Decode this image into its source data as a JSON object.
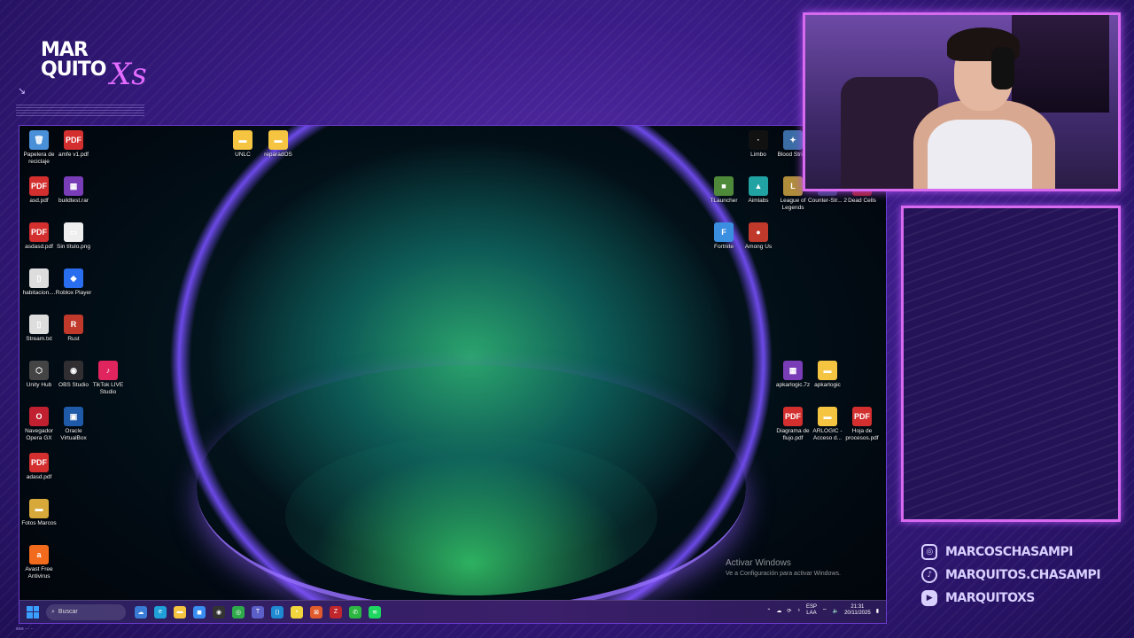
{
  "overlay": {
    "brand_line1": "MAR",
    "brand_line2": "QUITO",
    "brand_script": "Xs",
    "brand_arrow": "↘",
    "bottom_tiny": "≡≡≡ ··· ··"
  },
  "desktop_icons": [
    {
      "label": "Papelera de reciclaje",
      "glyph": "🗑",
      "color": "#4a90d9"
    },
    {
      "label": "amfe v1.pdf",
      "glyph": "PDF",
      "color": "#d32f2f"
    },
    {
      "label": "UNLC",
      "glyph": "▬",
      "color": "#f5c542"
    },
    {
      "label": "reparadOS",
      "glyph": "▬",
      "color": "#f5c542"
    },
    {
      "label": "Limbo",
      "glyph": "·",
      "color": "#111111"
    },
    {
      "label": "Blood Strike",
      "glyph": "✦",
      "color": "#3a6ea5"
    },
    {
      "label": "asd.pdf",
      "glyph": "PDF",
      "color": "#d32f2f"
    },
    {
      "label": "buildtest.rar",
      "glyph": "▦",
      "color": "#7a3db8"
    },
    {
      "label": "TLauncher",
      "glyph": "■",
      "color": "#4f8a3a"
    },
    {
      "label": "Aimlabs",
      "glyph": "▲",
      "color": "#21a3a3"
    },
    {
      "label": "League of Legends",
      "glyph": "L",
      "color": "#b08d3a"
    },
    {
      "label": "Counter-Str... 2",
      "glyph": "CS",
      "color": "#2b3a66"
    },
    {
      "label": "Dead Cells",
      "glyph": "●",
      "color": "#a01818"
    },
    {
      "label": "asdasd.pdf",
      "glyph": "PDF",
      "color": "#d32f2f"
    },
    {
      "label": "Sin título.png",
      "glyph": "▭",
      "color": "#eeeeee"
    },
    {
      "label": "Fortnite",
      "glyph": "F",
      "color": "#3b8fe0"
    },
    {
      "label": "Among Us",
      "glyph": "●",
      "color": "#c0392b"
    },
    {
      "label": "habitacion....",
      "glyph": "▯",
      "color": "#dddddd"
    },
    {
      "label": "Roblox Player",
      "glyph": "◆",
      "color": "#2a6ef0"
    },
    {
      "label": "Stream.txt",
      "glyph": "▯",
      "color": "#dddddd"
    },
    {
      "label": "Rust",
      "glyph": "R",
      "color": "#c0392b"
    },
    {
      "label": "Unity Hub",
      "glyph": "⬡",
      "color": "#444444"
    },
    {
      "label": "OBS Studio",
      "glyph": "◉",
      "color": "#302e31"
    },
    {
      "label": "TikTok LIVE Studio",
      "glyph": "♪",
      "color": "#e0245e"
    },
    {
      "label": "apkarlogic.7z",
      "glyph": "▦",
      "color": "#7a3db8"
    },
    {
      "label": "apkarlogic",
      "glyph": "▬",
      "color": "#f5c542"
    },
    {
      "label": "Navegador Opera GX",
      "glyph": "O",
      "color": "#c0202f"
    },
    {
      "label": "Oracle VirtualBox",
      "glyph": "▣",
      "color": "#1e5aa8"
    },
    {
      "label": "Diagrama de flujo.pdf",
      "glyph": "PDF",
      "color": "#d32f2f"
    },
    {
      "label": "ARLOGIC - Acceso d...",
      "glyph": "▬",
      "color": "#f5c542"
    },
    {
      "label": "Hoja de procesos.pdf",
      "glyph": "PDF",
      "color": "#d32f2f"
    },
    {
      "label": "adasd.pdf",
      "glyph": "PDF",
      "color": "#d32f2f"
    },
    {
      "label": "Fotos Marcos",
      "glyph": "▬",
      "color": "#d6a93a"
    },
    {
      "label": "Avast Free Antivirus",
      "glyph": "a",
      "color": "#f26a1b"
    }
  ],
  "activation": {
    "title": "Activar Windows",
    "subtitle": "Ve a Configuración para activar Windows."
  },
  "taskbar": {
    "search_placeholder": "Buscar",
    "apps": [
      {
        "name": "widgets-icon",
        "glyph": "☁",
        "color": "#3a7bd5"
      },
      {
        "name": "edge-icon",
        "glyph": "e",
        "color": "#1fa0d8"
      },
      {
        "name": "explorer-icon",
        "glyph": "▬",
        "color": "#f5c542"
      },
      {
        "name": "store-icon",
        "glyph": "◼",
        "color": "#3a8df0"
      },
      {
        "name": "obs-icon",
        "glyph": "◉",
        "color": "#333333"
      },
      {
        "name": "chrome-icon",
        "glyph": "◎",
        "color": "#2faa4a"
      },
      {
        "name": "teams-icon",
        "glyph": "T",
        "color": "#5b5fc7"
      },
      {
        "name": "vscode-icon",
        "glyph": "⟨⟩",
        "color": "#1f8ad2"
      },
      {
        "name": "sticky-notes-icon",
        "glyph": "▪",
        "color": "#f2d43c"
      },
      {
        "name": "office-icon",
        "glyph": "⊠",
        "color": "#e05a2b"
      },
      {
        "name": "filezilla-icon",
        "glyph": "Z",
        "color": "#c0262c"
      },
      {
        "name": "whatsapp-icon",
        "glyph": "✆",
        "color": "#2bb741"
      },
      {
        "name": "spotify-icon",
        "glyph": "≋",
        "color": "#1ed760"
      }
    ],
    "lang_line1": "ESP",
    "lang_line2": "LAA",
    "time": "21:31",
    "date": "20/11/2025"
  },
  "socials": [
    {
      "icon": "instagram-icon",
      "glyph": "◎",
      "handle": "MARCOSCHASAMPI"
    },
    {
      "icon": "tiktok-icon",
      "glyph": "♪",
      "handle": "MARQUITOS.CHASAMPI"
    },
    {
      "icon": "youtube-icon",
      "glyph": "▶",
      "handle": "MARQUITOXS"
    }
  ]
}
